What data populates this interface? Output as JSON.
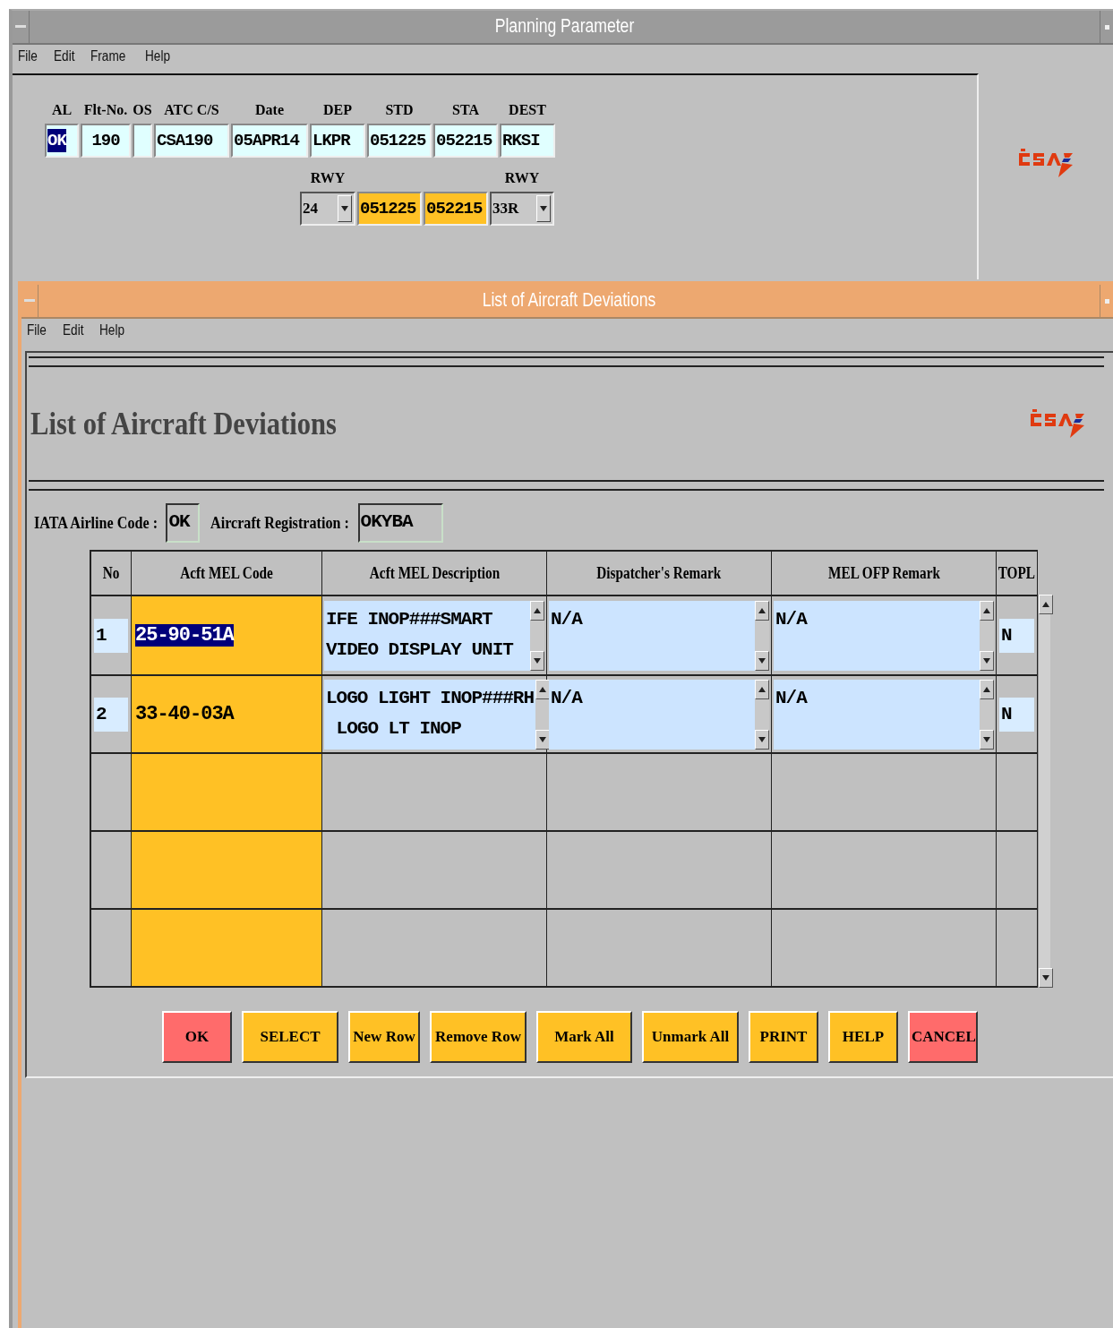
{
  "window": {
    "title": "Planning Parameter",
    "menu": [
      "File",
      "Edit",
      "Frame",
      "Help"
    ]
  },
  "flight_fields": [
    {
      "label": "AL",
      "value": "OK",
      "highlighted": true
    },
    {
      "label": "Flt-No.",
      "value": "190",
      "highlighted": false
    },
    {
      "label": "OS",
      "highlighted": false
    },
    {
      "label": "ATC C/S",
      "value": "CSA190",
      "highlighted": false
    },
    {
      "label": "Date",
      "value": "05APR14",
      "highlighted": false
    },
    {
      "label": "DEP",
      "value": "LKPR",
      "highlighted": false
    },
    {
      "label": "STD",
      "value": "051225",
      "highlighted": false
    },
    {
      "label": "STA",
      "value": "052215",
      "highlighted": false
    },
    {
      "label": "DEST",
      "value": "RKSI",
      "highlighted": false
    }
  ],
  "runway_row": [
    {
      "kind": "dropdown",
      "label": "RWY",
      "value": "24"
    },
    {
      "kind": "time",
      "value": "051225"
    },
    {
      "kind": "time",
      "value": "052215"
    },
    {
      "kind": "dropdown",
      "label": "RWY",
      "value": "33R"
    }
  ],
  "dialog": {
    "title": "List of Aircraft Deviations",
    "menu": [
      "File",
      "Edit",
      "Help"
    ],
    "heading": "List of Aircraft Deviations",
    "airline_code_label": "IATA Airline Code :",
    "airline_code": "OK",
    "registration_label": "Aircraft Registration :",
    "registration": "OKYBA",
    "table": {
      "columns": [
        "No",
        "Acft MEL Code",
        "Acft MEL Description",
        "Dispatcher's Remark",
        "MEL OFP Remark",
        "TOPL"
      ],
      "rows": [
        {
          "no": "1",
          "mel_code": "25-90-51A",
          "highlighted": true,
          "description": "IFE INOP###SMART\nVIDEO DISPLAY UNIT",
          "dispatcher_remark": "N/A",
          "ofp_remark": "N/A",
          "topl": "N"
        },
        {
          "no": "2",
          "mel_code": "33-40-03A",
          "highlighted": false,
          "description": "LOGO LIGHT INOP###RH\n LOGO LT INOP",
          "dispatcher_remark": "N/A",
          "ofp_remark": "N/A",
          "topl": "N"
        }
      ]
    },
    "buttons": [
      {
        "label": "OK",
        "color": "#ff6b6b"
      },
      {
        "label": "SELECT",
        "color": "#ffc125"
      },
      {
        "label": "New Row",
        "color": "#ffc125"
      },
      {
        "label": "Remove Row",
        "color": "#ffc125"
      },
      {
        "label": "Mark All",
        "color": "#ffc125"
      },
      {
        "label": "Unmark All",
        "color": "#ffc125"
      },
      {
        "label": "PRINT",
        "color": "#ffc125"
      },
      {
        "label": "HELP",
        "color": "#ffc125"
      },
      {
        "label": "CANCEL",
        "color": "#ff6b6b"
      }
    ]
  }
}
